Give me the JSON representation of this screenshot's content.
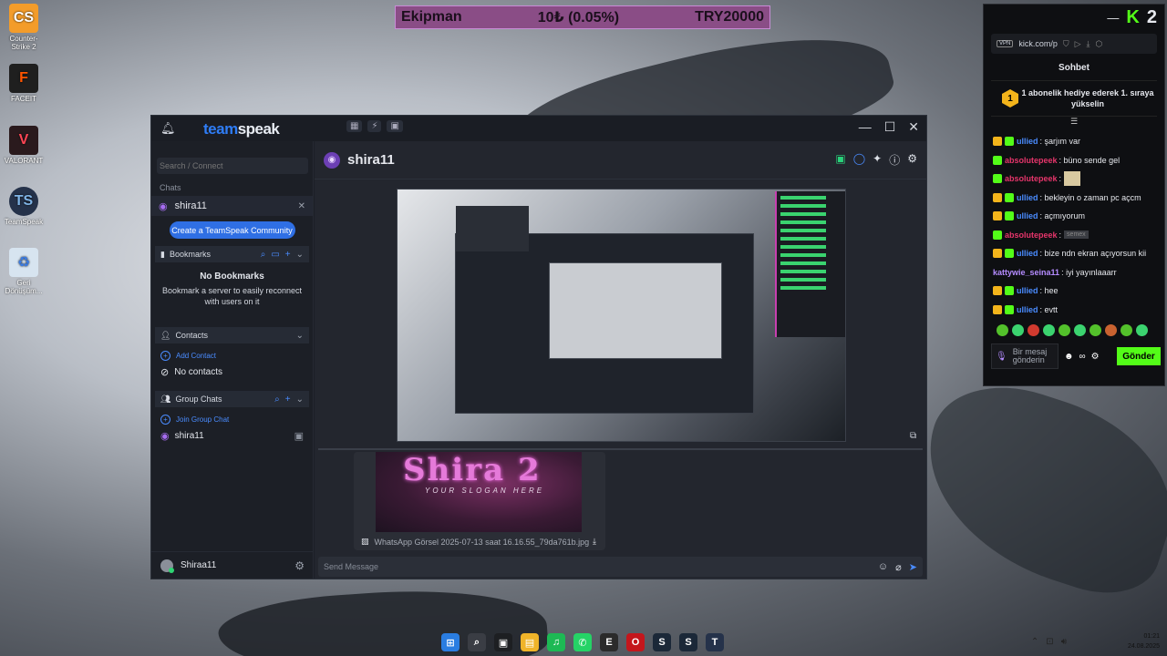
{
  "desktop": {
    "icons": [
      {
        "label": "Counter-Strike 2",
        "glyph": "CS",
        "color": "#f39c2a"
      },
      {
        "label": "FACEIT",
        "glyph": "F",
        "color": "#ff5500"
      },
      {
        "label": "VALORANT",
        "glyph": "V",
        "color": "#ff4655"
      },
      {
        "label": "TeamSpeak",
        "glyph": "TS",
        "color": "#3b7be0"
      },
      {
        "label": "Geri Dönüşüm...",
        "glyph": "♻",
        "color": "#7fb4e6"
      }
    ]
  },
  "overlay": {
    "left": "Ekipman",
    "middle": "10₺ (0.05%)",
    "right": "TRY20000"
  },
  "teamspeak": {
    "logo_a": "team",
    "logo_b": "speak",
    "search_placeholder": "Search / Connect",
    "chats_label": "Chats",
    "active_chat": "shira11",
    "community_button": "Create a TeamSpeak Community",
    "bookmarks": {
      "title": "Bookmarks",
      "empty_title": "No Bookmarks",
      "empty_text": "Bookmark a server to easily reconnect with users on it"
    },
    "contacts": {
      "title": "Contacts",
      "add": "Add Contact",
      "empty": "No contacts"
    },
    "group_chats": {
      "title": "Group Chats",
      "join": "Join Group Chat",
      "item": "shira11"
    },
    "user": "Shiraa11",
    "channel_name": "shira11",
    "image_card": {
      "title": "Shira 2",
      "subtitle": "YOUR SLOGAN HERE",
      "filename": "WhatsApp Görsel 2025-07-13 saat 16.16.55_79da761b.jpg"
    },
    "message_placeholder": "Send Message"
  },
  "kick": {
    "brand": "K",
    "count": "2",
    "url": "kick.com/p",
    "title": "Sohbet",
    "gift_text": "1 abonelik hediye ederek 1. sıraya yükselin",
    "gift_rank": "1",
    "messages": [
      {
        "user": "ullied",
        "color": "#4a8cff",
        "text": "şarjım var",
        "badges": 2
      },
      {
        "user": "absolutepeek",
        "color": "#e6356b",
        "text": "büno sende gel",
        "badges": 1
      },
      {
        "user": "absolutepeek",
        "color": "#e6356b",
        "text": "",
        "badges": 1,
        "emote": true
      },
      {
        "user": "ullied",
        "color": "#4a8cff",
        "text": "bekleyin o zaman pc açcm",
        "badges": 2
      },
      {
        "user": "ullied",
        "color": "#4a8cff",
        "text": "açmıyorum",
        "badges": 2
      },
      {
        "user": "absolutepeek",
        "color": "#e6356b",
        "text": "",
        "badges": 1,
        "tag": "semex"
      },
      {
        "user": "ullied",
        "color": "#4a8cff",
        "text": "bize ndn ekran açıyorsun kii",
        "badges": 2
      },
      {
        "user": "kattywie_seina11",
        "color": "#b58cff",
        "text": "iyi yayınlaaarr",
        "badges": 0
      },
      {
        "user": "ullied",
        "color": "#4a8cff",
        "text": "hee",
        "badges": 2
      },
      {
        "user": "ullied",
        "color": "#4a8cff",
        "text": "evtt",
        "badges": 2
      }
    ],
    "input_placeholder": "Bir mesaj gönderin",
    "send_label": "Gönder"
  },
  "taskbar": {
    "time": "01:21",
    "date": "24.08.2025"
  }
}
